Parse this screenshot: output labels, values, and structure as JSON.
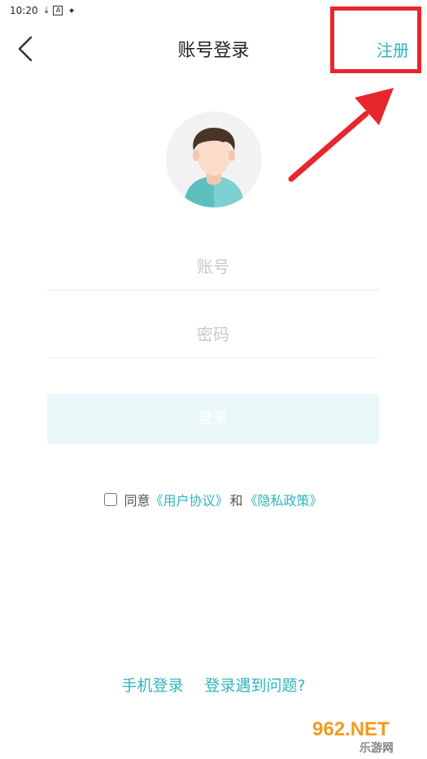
{
  "status_bar": {
    "time": "10:20",
    "icons": [
      "download-icon",
      "notification-icon",
      "game-icon"
    ]
  },
  "header": {
    "title": "账号登录",
    "register_label": "注册"
  },
  "form": {
    "account_placeholder": "账号",
    "password_placeholder": "密码",
    "login_label": "登录"
  },
  "agreement": {
    "prefix": "同意",
    "user_agreement": "《用户协议》",
    "and": "和",
    "privacy_policy": "《隐私政策》"
  },
  "footer": {
    "phone_login": "手机登录",
    "login_problem": "登录遇到问题?"
  },
  "watermark": {
    "brand": "962.NET",
    "subtitle": "乐游网"
  },
  "colors": {
    "accent": "#2fb4bf",
    "highlight": "#e8262d",
    "login_button_bg": "#eaf7f8"
  }
}
